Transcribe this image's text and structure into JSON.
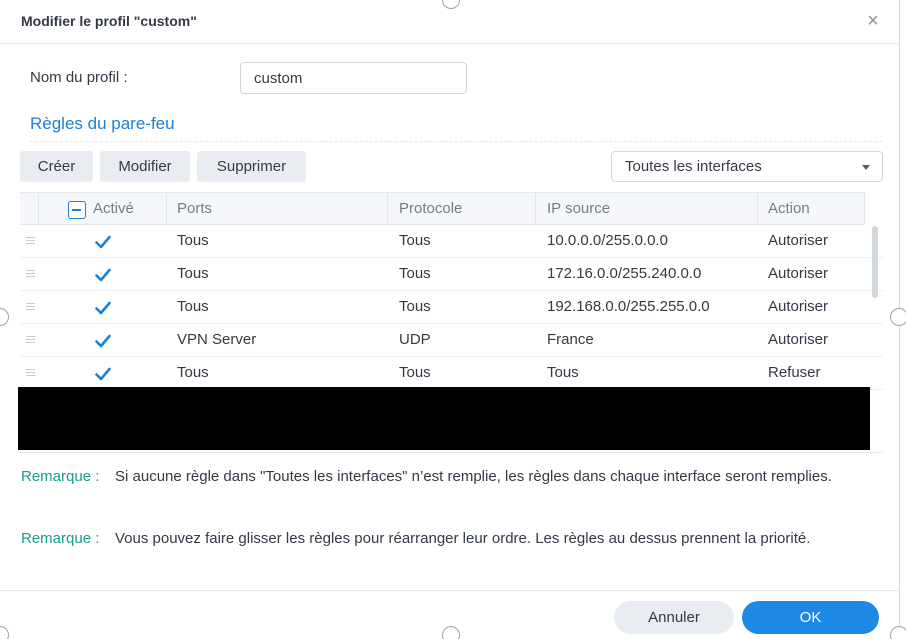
{
  "dialog": {
    "title": "Modifier le profil \"custom\"",
    "close_icon": "close-icon"
  },
  "profile": {
    "label": "Nom du profil :",
    "value": "custom"
  },
  "section": {
    "title": "Règles du pare-feu"
  },
  "toolbar": {
    "create_label": "Créer",
    "modify_label": "Modifier",
    "delete_label": "Supprimer",
    "interface_select": "Toutes les interfaces"
  },
  "table": {
    "headers": [
      "Activé",
      "Ports",
      "Protocole",
      "IP source",
      "Action"
    ],
    "rows": [
      {
        "enabled": true,
        "ports": "Tous",
        "protocol": "Tous",
        "source_ip": "10.0.0.0/255.0.0.0",
        "action": "Autoriser"
      },
      {
        "enabled": true,
        "ports": "Tous",
        "protocol": "Tous",
        "source_ip": "172.16.0.0/255.240.0.0",
        "action": "Autoriser"
      },
      {
        "enabled": true,
        "ports": "Tous",
        "protocol": "Tous",
        "source_ip": "192.168.0.0/255.255.0.0",
        "action": "Autoriser"
      },
      {
        "enabled": true,
        "ports": "VPN Server",
        "protocol": "UDP",
        "source_ip": "France",
        "action": "Autoriser"
      },
      {
        "enabled": true,
        "ports": "Tous",
        "protocol": "Tous",
        "source_ip": "Tous",
        "action": "Refuser"
      }
    ]
  },
  "notes": [
    {
      "label": "Remarque :",
      "text": "Si aucune règle dans \"Toutes les interfaces\" n’est remplie, les règles dans chaque interface seront remplies."
    },
    {
      "label": "Remarque :",
      "text": "Vous pouvez faire glisser les règles pour réarranger leur ordre. Les règles au dessus prennent la priorité."
    }
  ],
  "footer": {
    "cancel_label": "Annuler",
    "ok_label": "OK"
  },
  "colors": {
    "accent": "#1e88e5",
    "link": "#1e7fd6",
    "note_label": "#1a9c8f"
  }
}
